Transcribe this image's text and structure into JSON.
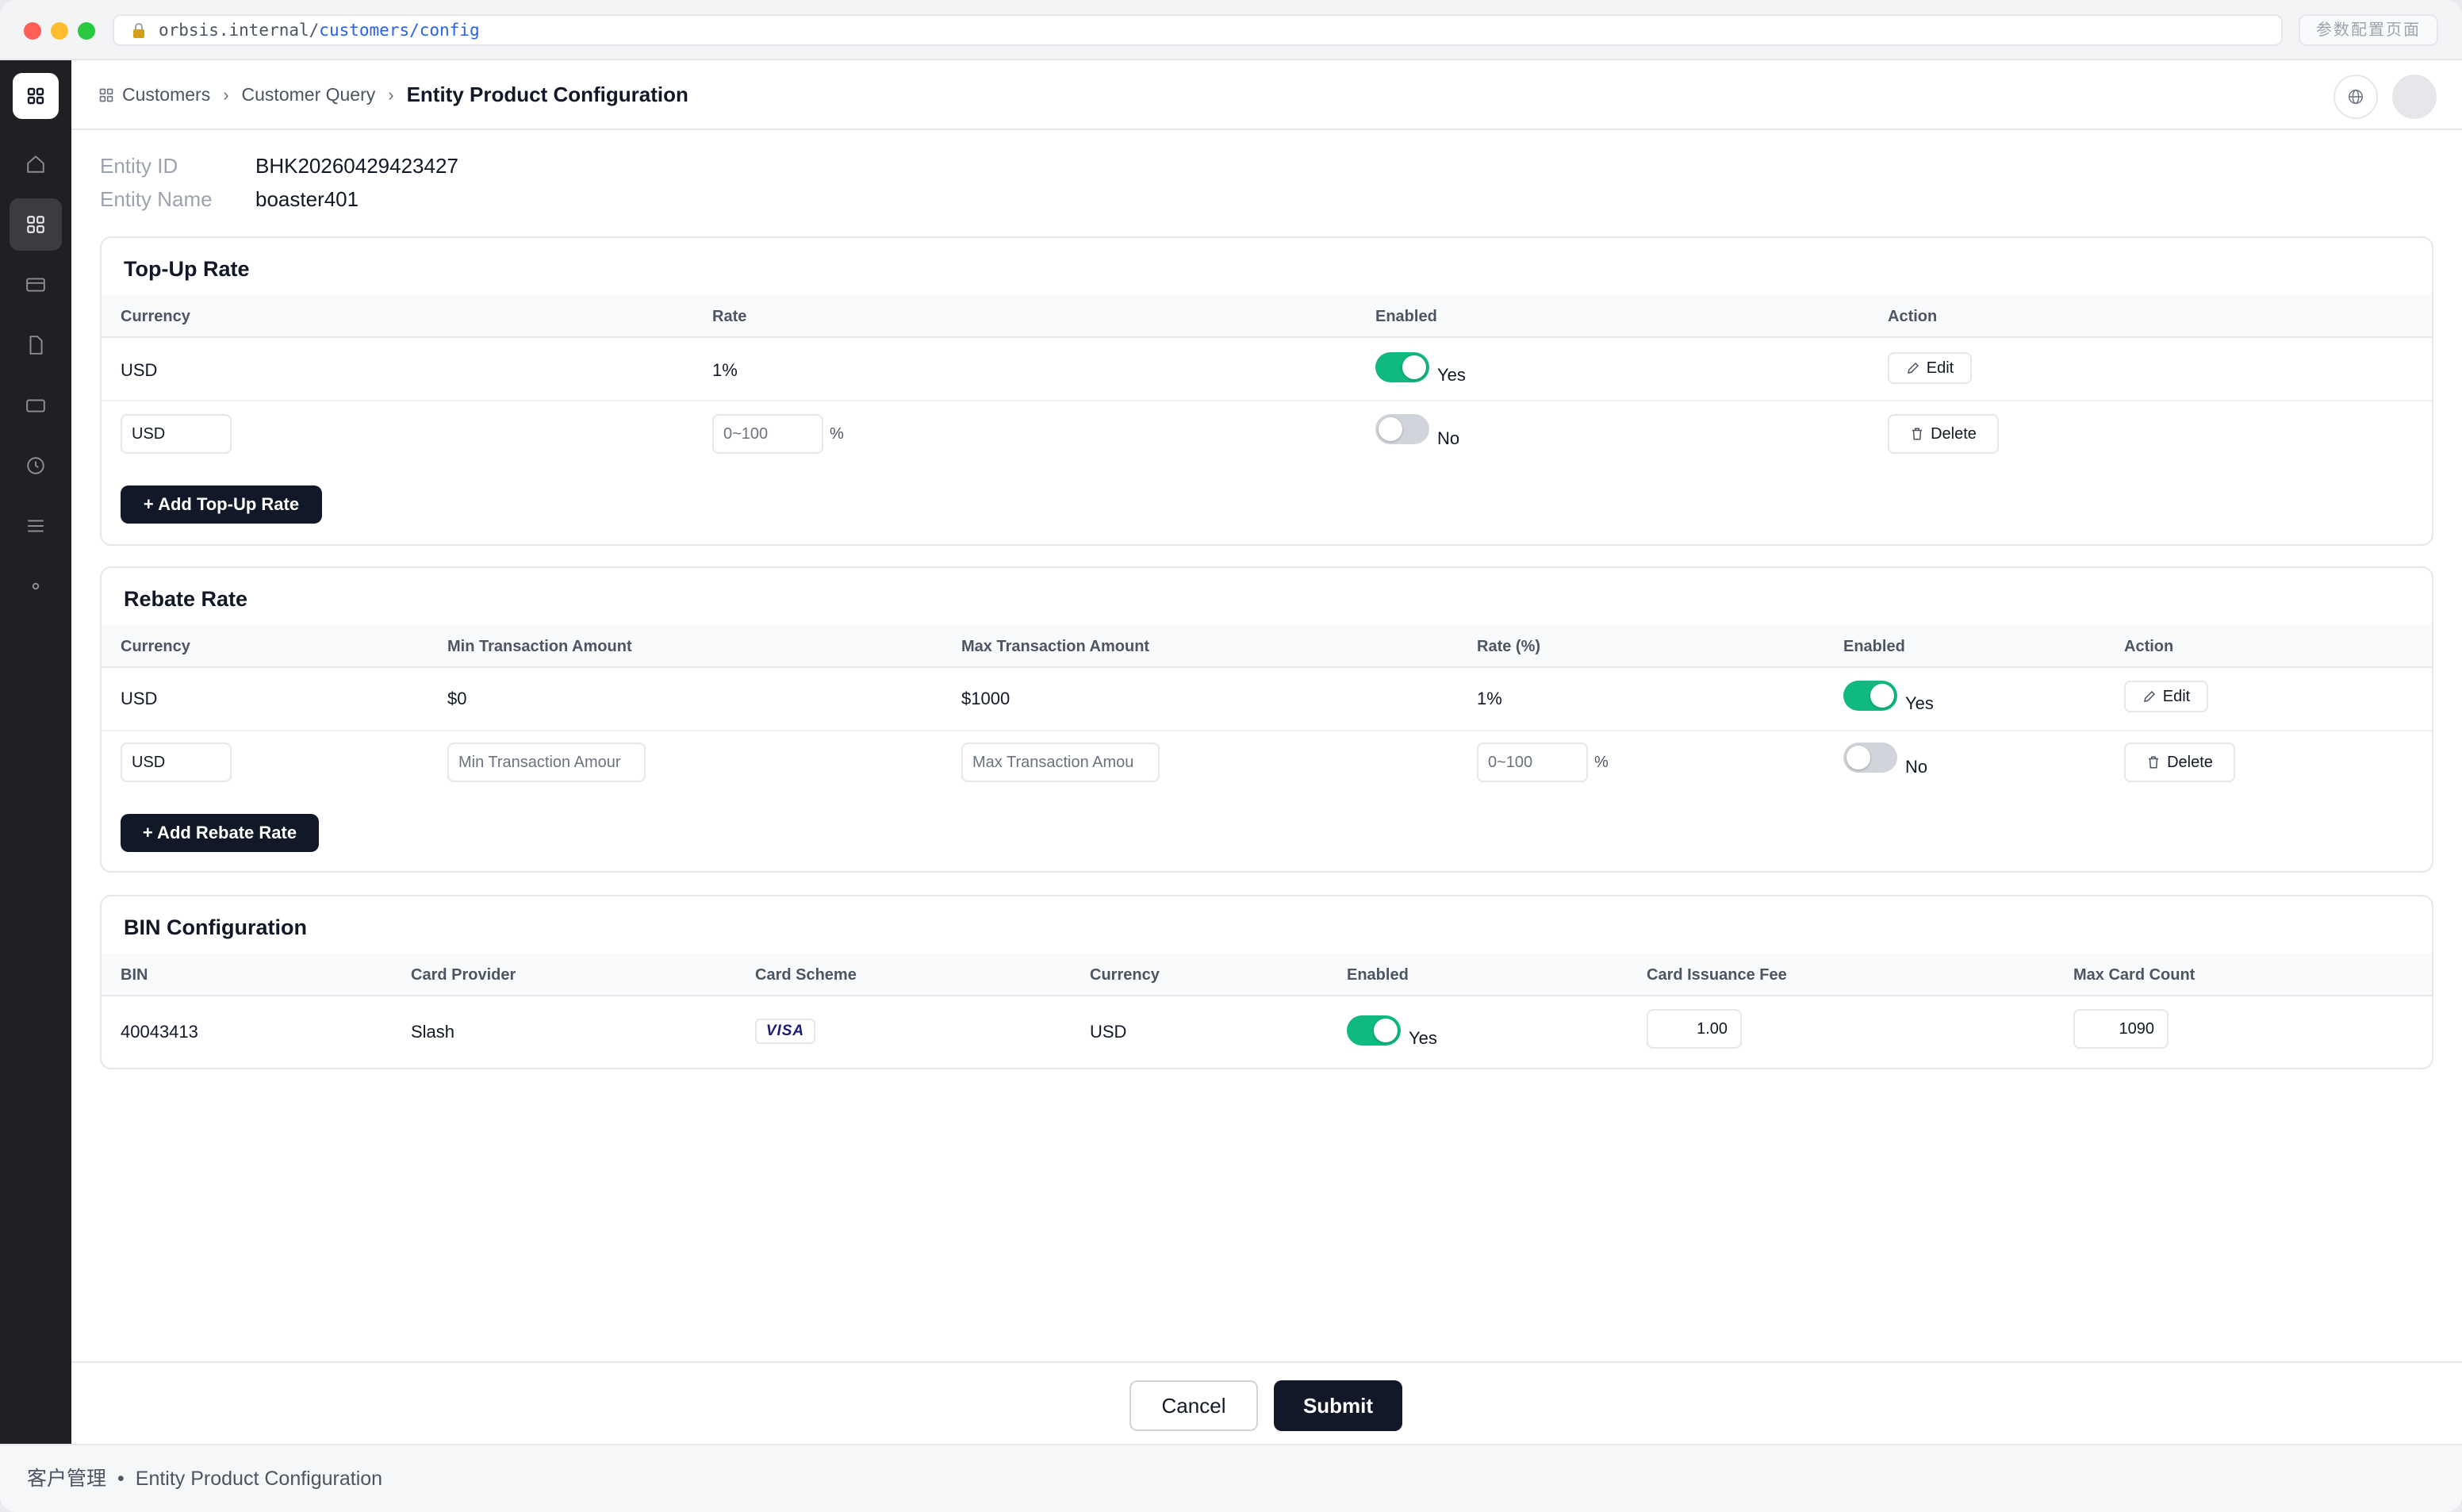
{
  "browser": {
    "url_host": "orbsis.internal/",
    "url_path": "customers/config",
    "tab_button": "参数配置页面"
  },
  "rail": {
    "items": [
      "grid-icon",
      "home-icon",
      "apps-icon",
      "card-icon",
      "file-icon",
      "tablet-icon",
      "clock-icon",
      "menu-icon",
      "dot-icon"
    ],
    "active": "apps-icon"
  },
  "breadcrumb": {
    "items": [
      "Customers",
      "Customer Query"
    ],
    "current": "Entity Product Configuration"
  },
  "entity": {
    "id_label": "Entity ID",
    "id_value": "BHK20260429423427",
    "name_label": "Entity Name",
    "name_value": "boaster401"
  },
  "topup": {
    "title": "Top-Up Rate",
    "columns": [
      "Currency",
      "Rate",
      "Enabled",
      "Action"
    ],
    "row": {
      "currency": "USD",
      "rate": "1%",
      "enabled": true,
      "enabled_label": "Yes",
      "action": "Edit"
    },
    "new_row": {
      "currency": "USD",
      "rate_placeholder": "0~100",
      "unit": "%",
      "enabled": false,
      "enabled_label": "No",
      "action": "Delete"
    },
    "add_label": "+ Add Top-Up Rate"
  },
  "rebate": {
    "title": "Rebate Rate",
    "columns": [
      "Currency",
      "Min Transaction Amount",
      "Max Transaction Amount",
      "Rate (%)",
      "Enabled",
      "Action"
    ],
    "row": {
      "currency": "USD",
      "min": "$0",
      "max": "$1000",
      "rate": "1%",
      "enabled": true,
      "enabled_label": "Yes",
      "action": "Edit"
    },
    "new_row": {
      "currency": "USD",
      "min_placeholder": "Min Transaction Amour",
      "max_placeholder": "Max Transaction Amou",
      "rate_placeholder": "0~100",
      "unit": "%",
      "enabled": false,
      "enabled_label": "No",
      "action": "Delete"
    },
    "add_label": "+ Add Rebate Rate"
  },
  "bin": {
    "title": "BIN Configuration",
    "columns": [
      "BIN",
      "Card Provider",
      "Card Scheme",
      "Currency",
      "Enabled",
      "Card Issuance Fee",
      "Max Card Count"
    ],
    "row": {
      "bin": "40043413",
      "provider": "Slash",
      "scheme": "VISA",
      "currency": "USD",
      "enabled": true,
      "enabled_label": "Yes",
      "fee": "1.00",
      "max_count": "1090"
    }
  },
  "actions": {
    "cancel": "Cancel",
    "submit": "Submit"
  },
  "status": {
    "section": "客户管理",
    "separator": "•",
    "page": "Entity Product Configuration"
  }
}
